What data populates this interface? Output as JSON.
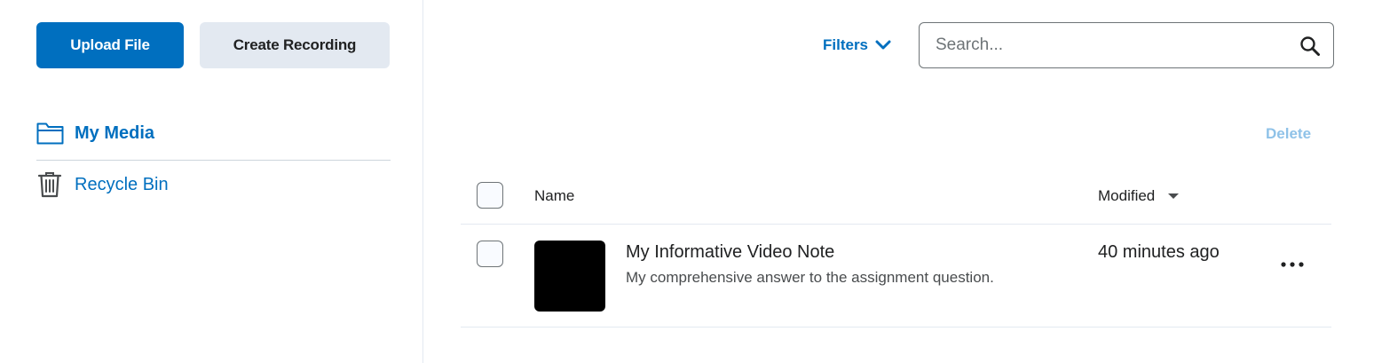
{
  "sidebar": {
    "upload_label": "Upload File",
    "create_recording_label": "Create Recording",
    "items": [
      {
        "label": "My Media",
        "icon": "folder-icon",
        "active": true
      },
      {
        "label": "Recycle Bin",
        "icon": "trash-icon",
        "active": false
      }
    ]
  },
  "toolbar": {
    "filters_label": "Filters",
    "search_placeholder": "Search...",
    "search_value": "",
    "delete_label": "Delete"
  },
  "table": {
    "columns": {
      "name": "Name",
      "modified": "Modified"
    },
    "rows": [
      {
        "title": "My Informative Video Note",
        "description": "My comprehensive answer to the assignment question.",
        "modified": "40 minutes ago"
      }
    ]
  },
  "colors": {
    "accent": "#006fbf",
    "secondary_bg": "#e3e9f1",
    "disabled_link": "#8fc2e8"
  }
}
